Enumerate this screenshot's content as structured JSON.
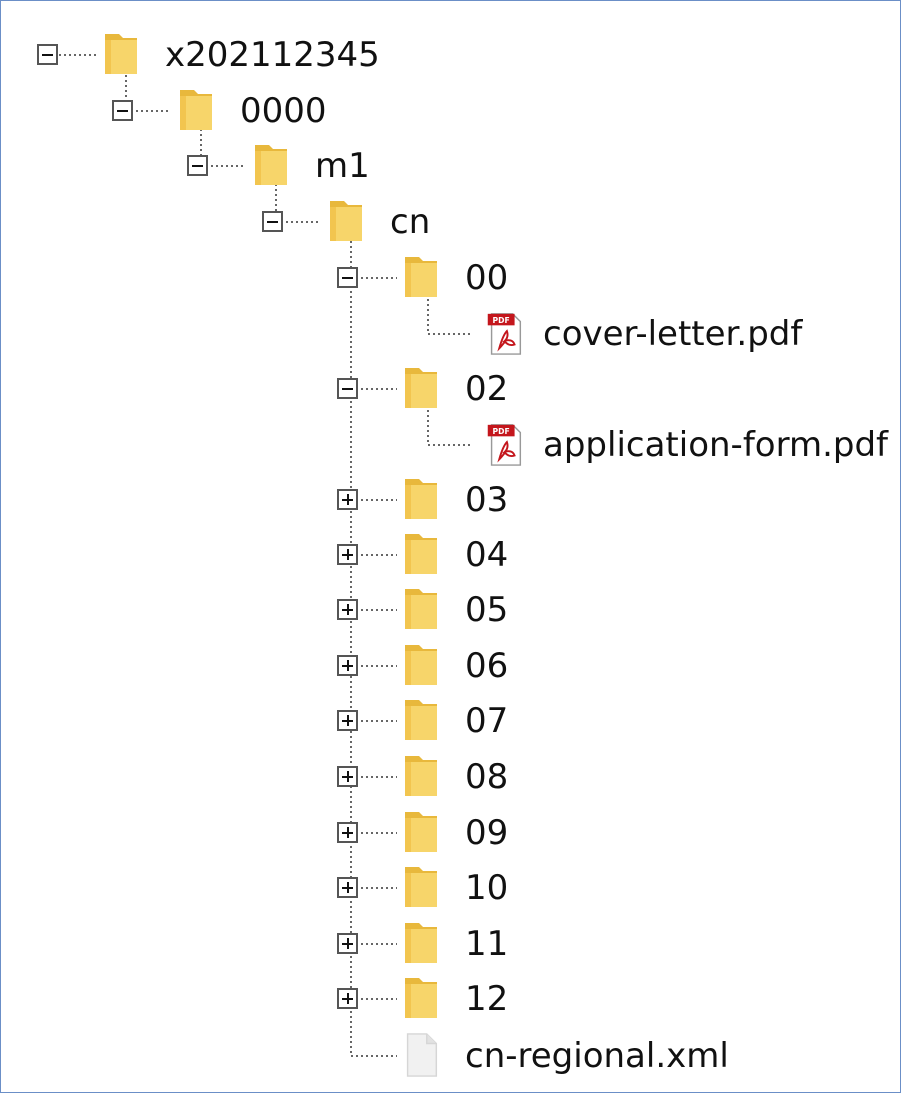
{
  "tree": {
    "root": {
      "label": "x202112345",
      "state": "expanded",
      "icon": "folder-icon"
    },
    "n0000": {
      "label": "0000",
      "state": "expanded",
      "icon": "folder-icon"
    },
    "m1": {
      "label": "m1",
      "state": "expanded",
      "icon": "folder-icon"
    },
    "cn": {
      "label": "cn",
      "state": "expanded",
      "icon": "folder-icon"
    },
    "f00": {
      "label": "00",
      "state": "expanded",
      "icon": "folder-icon"
    },
    "cover": {
      "label": "cover-letter.pdf",
      "icon": "pdf-file-icon"
    },
    "f02": {
      "label": "02",
      "state": "expanded",
      "icon": "folder-icon"
    },
    "appform": {
      "label": "application-form.pdf",
      "icon": "pdf-file-icon"
    },
    "f03": {
      "label": "03",
      "state": "collapsed",
      "icon": "folder-icon"
    },
    "f04": {
      "label": "04",
      "state": "collapsed",
      "icon": "folder-icon"
    },
    "f05": {
      "label": "05",
      "state": "collapsed",
      "icon": "folder-icon"
    },
    "f06": {
      "label": "06",
      "state": "collapsed",
      "icon": "folder-icon"
    },
    "f07": {
      "label": "07",
      "state": "collapsed",
      "icon": "folder-icon"
    },
    "f08": {
      "label": "08",
      "state": "collapsed",
      "icon": "folder-icon"
    },
    "f09": {
      "label": "09",
      "state": "collapsed",
      "icon": "folder-icon"
    },
    "f10": {
      "label": "10",
      "state": "collapsed",
      "icon": "folder-icon"
    },
    "f11": {
      "label": "11",
      "state": "collapsed",
      "icon": "folder-icon"
    },
    "f12": {
      "label": "12",
      "state": "collapsed",
      "icon": "folder-icon"
    },
    "xml": {
      "label": "cn-regional.xml",
      "icon": "generic-file-icon"
    }
  },
  "colors": {
    "folder": "#f7d56a",
    "folder_shade": "#e8b83c",
    "pdf_red": "#c4161c",
    "panel_border": "#6b8fc7",
    "connector": "#666666"
  }
}
